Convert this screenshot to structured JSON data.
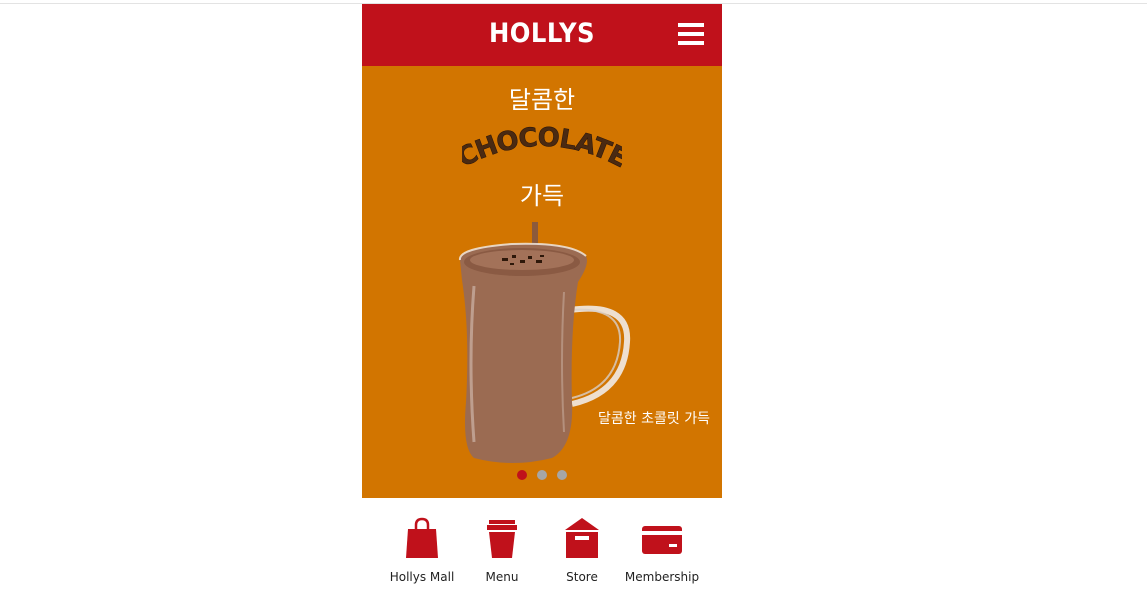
{
  "header": {
    "logo": "HOLLYS",
    "menu_icon": "hamburger-menu-icon"
  },
  "banner": {
    "headline_top": "달콤한",
    "headline_word": "CHOCOLATE",
    "headline_bottom": "가득",
    "caption": "달콤한 초콜릿 가득",
    "background_color": "#d27500",
    "slides_total": 3,
    "active_slide": 1
  },
  "nav": {
    "items": [
      {
        "label": "Hollys Mall",
        "icon": "shopping-bag-icon"
      },
      {
        "label": "Menu",
        "icon": "coffee-cup-icon"
      },
      {
        "label": "Store",
        "icon": "store-icon"
      },
      {
        "label": "Membership",
        "icon": "membership-card-icon"
      }
    ]
  },
  "colors": {
    "brand_red": "#c0111b",
    "banner_orange": "#d27500",
    "inactive_dot": "#a6a6a6"
  }
}
